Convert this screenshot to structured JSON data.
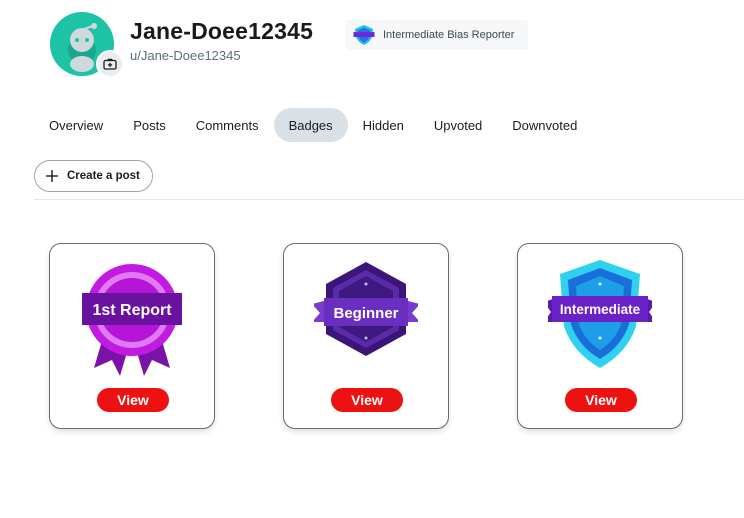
{
  "profile": {
    "username": "Jane-Doee12345",
    "handle": "u/Jane-Doee12345",
    "rank_label": "Intermediate Bias Reporter",
    "avatar_icon": "reddit-avatar-icon",
    "camera_icon": "camera-add-icon"
  },
  "tabs": [
    {
      "label": "Overview",
      "active": false
    },
    {
      "label": "Posts",
      "active": false
    },
    {
      "label": "Comments",
      "active": false
    },
    {
      "label": "Badges",
      "active": true
    },
    {
      "label": "Hidden",
      "active": false
    },
    {
      "label": "Upvoted",
      "active": false
    },
    {
      "label": "Downvoted",
      "active": false
    }
  ],
  "actions": {
    "create_post_label": "Create a post",
    "create_post_icon": "plus-icon"
  },
  "badges": [
    {
      "title": "1st Report",
      "button_label": "View",
      "color": "#b01ad6"
    },
    {
      "title": "Beginner",
      "button_label": "View",
      "color": "#4b1a8c"
    },
    {
      "title": "Intermediate",
      "button_label": "View",
      "color": "#19c3e6"
    }
  ],
  "colors": {
    "accent_red": "#ee1111",
    "avatar_teal": "#1ec3a6",
    "tab_active_bg": "#d9e0e6"
  }
}
